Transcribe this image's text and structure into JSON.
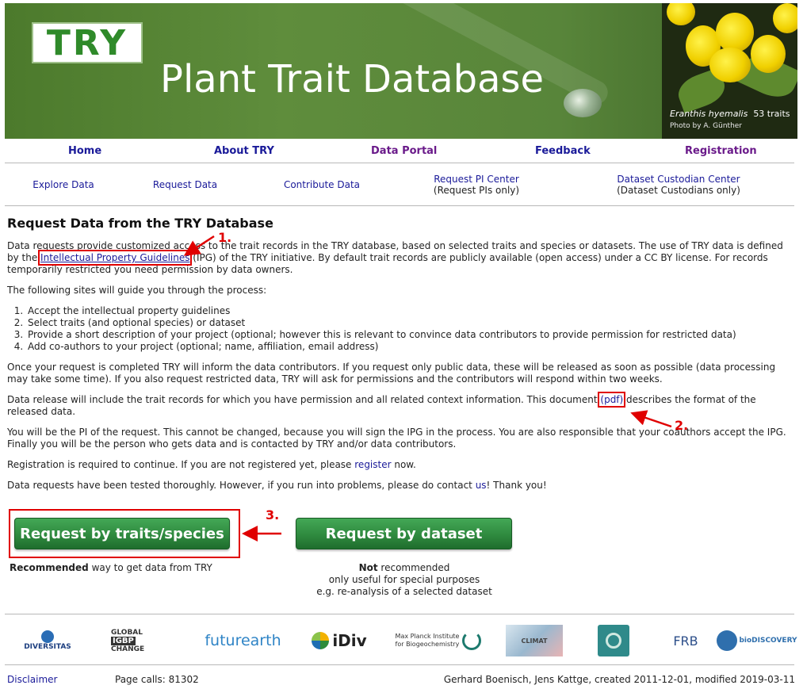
{
  "banner": {
    "logo_text": "TRY",
    "title": "Plant Trait Database",
    "species": "Eranthis hyemalis",
    "traits": "53 traits",
    "photo_credit": "Photo by A. Günther"
  },
  "nav": {
    "home": "Home",
    "about": "About TRY",
    "portal": "Data Portal",
    "feedback": "Feedback",
    "registration": "Registration"
  },
  "subnav": {
    "explore": "Explore Data",
    "request": "Request Data",
    "contribute": "Contribute Data",
    "pi_center": "Request PI Center",
    "pi_center_note": "(Request PIs only)",
    "custodian_center": "Dataset Custodian Center",
    "custodian_center_note": "(Dataset Custodians only)"
  },
  "content": {
    "title": "Request Data from the TRY Database",
    "p1_a": "Data requests provide customized access to the trait records in the TRY database, based on selected traits and species or datasets. The use of TRY data is defined by the ",
    "p1_link": "Intellectual Property Guidelines",
    "p1_b": " (IPG) of the TRY initiative. By default trait records are publicly available (open access) under a CC BY license. For records temporarily restricted you need permission by data owners.",
    "p2": "The following sites will guide you through the process:",
    "steps": [
      "Accept the intellectual property guidelines",
      "Select traits (and optional species) or dataset",
      "Provide a short description of your project (optional; however this is relevant to convince data contributors to provide permission for restricted data)",
      "Add co-authors to your project (optional; name, affiliation, email address)"
    ],
    "p3": "Once your request is completed TRY will inform the data contributors. If you request only public data, these will be released as soon as possible (data processing may take some time). If you also request restricted data, TRY will ask for permissions and the contributors will respond within two weeks.",
    "p4_a": "Data release will include the trait records for which you have permission and all related context information. This document ",
    "p4_link": "(pdf)",
    "p4_b": " describes the format of the released data.",
    "p5": "You will be the PI of the request. This cannot be changed, because you will sign the IPG in the process. You are also responsible that your coauthors accept the IPG. Finally you will be the person who gets data and is contacted by TRY and/or data contributors.",
    "p6_a": "Registration is required to continue. If you are not registered yet, please ",
    "p6_link": "register",
    "p6_b": " now.",
    "p7_a": "Data requests have been tested thoroughly. However, if you run into problems, please do contact ",
    "p7_link": "us",
    "p7_b": "! Thank you!"
  },
  "buttons": {
    "traits_label": "Request by traits/species",
    "traits_note_bold": "Recommended",
    "traits_note": " way to get data from TRY",
    "dataset_label": "Request by dataset",
    "dataset_note_bold": "Not",
    "dataset_note_1": " recommended",
    "dataset_note_2": "only useful for special purposes",
    "dataset_note_3": "e.g. re-analysis of a selected dataset"
  },
  "annotations": {
    "n1": "1.",
    "n2": "2.",
    "n3": "3.",
    "color": "#e00000"
  },
  "partners": {
    "diversitas": "DIVERSITAS",
    "igbp_1": "GLOBAL",
    "igbp_2": "IGBP",
    "igbp_3": "CHANGE",
    "futurearth": "futurearth",
    "idiv": "iDiv",
    "mpi_1": "Max Planck Institute",
    "mpi_2": "for Biogeochemistry",
    "climat": "CLIMAT",
    "frb": "FRB",
    "biodiscovery": "bioDISCOVERY"
  },
  "footer": {
    "disclaimer": "Disclaimer",
    "page_calls": "Page calls: 81302",
    "credits": "Gerhard Boenisch, Jens Kattge, created 2011-12-01, modified 2019-03-11"
  },
  "colors": {
    "link": "#1a1a99",
    "visited": "#6a1a8a",
    "button_green": "#2f8a3f",
    "banner_green": "#5f8d3c"
  }
}
